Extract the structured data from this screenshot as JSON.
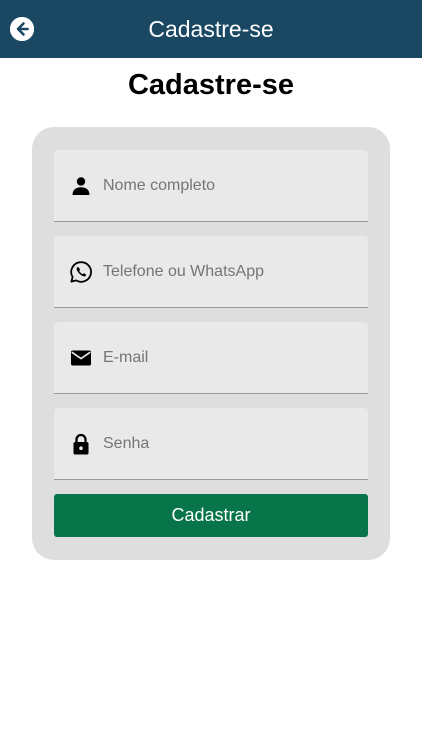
{
  "appbar": {
    "title": "Cadastre-se"
  },
  "page": {
    "title": "Cadastre-se"
  },
  "form": {
    "fields": [
      {
        "name": "name",
        "icon": "person-icon",
        "placeholder": "Nome completo",
        "value": ""
      },
      {
        "name": "phone",
        "icon": "whatsapp-icon",
        "placeholder": "Telefone ou WhatsApp",
        "value": ""
      },
      {
        "name": "email",
        "icon": "mail-icon",
        "placeholder": "E-mail",
        "value": ""
      },
      {
        "name": "password",
        "icon": "lock-icon",
        "placeholder": "Senha",
        "value": ""
      }
    ],
    "submit_label": "Cadastrar"
  },
  "colors": {
    "appbar": "#1a4863",
    "card": "#dedede",
    "field": "#e9e9e9",
    "button": "#08744a"
  }
}
